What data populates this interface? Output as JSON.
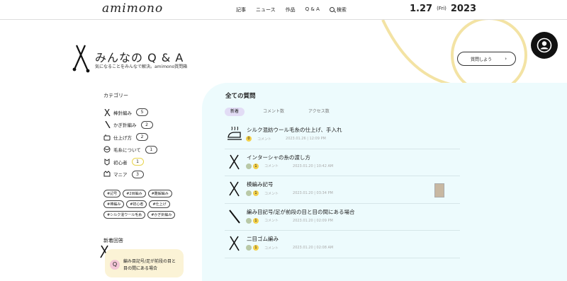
{
  "header": {
    "logo": "amimono",
    "nav": [
      "記事",
      "ニュース",
      "作品",
      "Q & A",
      "検索"
    ],
    "date": {
      "md": "1.27",
      "dow": "(Fri)",
      "year": "2023"
    }
  },
  "page": {
    "title": "みんなの Q & A",
    "subtitle": "気になることをみんなで解決。amimono質問箱",
    "ask_button": "質問しよう",
    "ask_arrow": "›"
  },
  "sidebar": {
    "category_title": "カテゴリー",
    "categories": [
      {
        "label": "棒針編み",
        "count": "5",
        "icon": "knitting-needles-icon"
      },
      {
        "label": "かぎ針編み",
        "count": "2",
        "icon": "crochet-hook-icon"
      },
      {
        "label": "仕上げ方",
        "count": "2",
        "icon": "finishing-icon"
      },
      {
        "label": "毛糸について",
        "count": "1",
        "icon": "yarn-icon"
      },
      {
        "label": "初心者",
        "count": "1",
        "icon": "beginner-icon"
      },
      {
        "label": "マニア",
        "count": "3",
        "icon": "mania-icon"
      }
    ],
    "tags": [
      "#記号",
      "#2目編み",
      "#難解編み",
      "#棒編み",
      "#初心者",
      "#仕上げ",
      "#シルク混ウール毛糸",
      "#かぎ針編み"
    ],
    "new_title": "新着回答",
    "new_card": {
      "badge": "Q",
      "text": "編み目記号/足が前段の目と目の間にある場合"
    }
  },
  "main": {
    "title": "全ての質問",
    "tabs": [
      "新着",
      "コメント数",
      "アクセス数"
    ],
    "items": [
      {
        "title": "シルク混紡ウール毛糸の仕上げ、手入れ",
        "count": "0",
        "label": "コメント",
        "date": "2023.01.26 | 12:09 PM",
        "icon": "iron-icon"
      },
      {
        "title": "インターシャの糸の渡し方",
        "count": "1",
        "label": "コメント",
        "date": "2023.01.20 | 10:42 AM",
        "icon": "knitting-needles-icon"
      },
      {
        "title": "模編み記号",
        "count": "1",
        "label": "コメント",
        "date": "2023.01.20 | 03:34 PM",
        "icon": "knitting-needles-icon"
      },
      {
        "title": "編み目記号/足が前段の目と目の間にある場合",
        "count": "1",
        "label": "コメント",
        "date": "2023.01.20 | 02:09 PM",
        "icon": "crochet-hook-icon"
      },
      {
        "title": "二目ゴム編み",
        "count": "1",
        "label": "コメント",
        "date": "2023.01.20 | 02:08 AM",
        "icon": "knitting-needles-icon"
      }
    ]
  },
  "colors": {
    "panel": "#edfbfd",
    "accent_yellow": "#f3d04a",
    "tab_active": "#e2dcf5",
    "card": "#fbf3d6"
  }
}
